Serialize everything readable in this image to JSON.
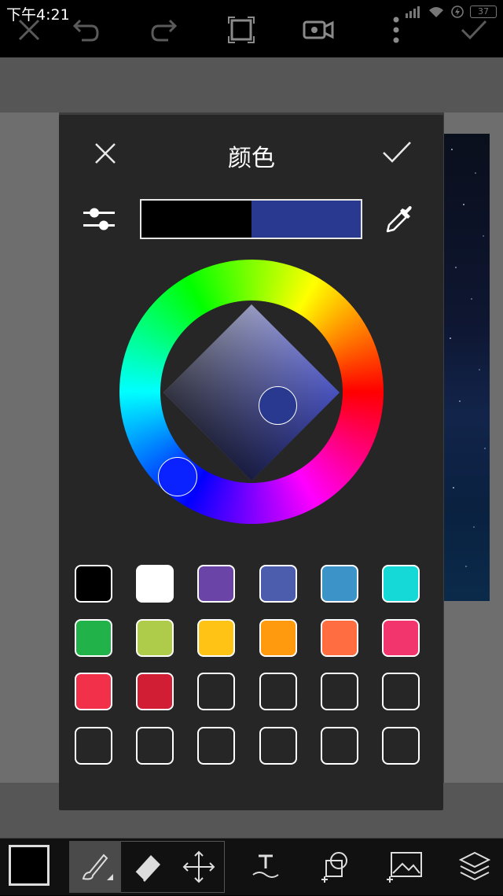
{
  "status_bar": {
    "time": "下午4:21",
    "battery": "37"
  },
  "toolbar_icons": [
    "close-icon",
    "undo-icon",
    "redo-icon",
    "crop-icon",
    "video-icon",
    "more-icon",
    "check-icon"
  ],
  "dialog": {
    "title": "颜色",
    "old_color": "#000000",
    "new_color": "#28398f",
    "selected_hue_color": "#0a22ff"
  },
  "swatches": [
    "#000000",
    "#ffffff",
    "#6a44a6",
    "#4d5dad",
    "#3c93c8",
    "#15d9d6",
    "#21b24a",
    "#afcb4a",
    "#ffc316",
    "#ff9a0f",
    "#ff6d40",
    "#f2366d",
    "#f2304a",
    "#d21e35",
    "empty",
    "empty",
    "empty",
    "empty",
    "empty",
    "empty",
    "empty",
    "empty",
    "empty",
    "empty"
  ],
  "bottom_tools": [
    "color-swatch",
    "brush-icon",
    "eraser-icon",
    "move-icon",
    "text-icon",
    "shapes-icon",
    "image-icon",
    "layers-icon"
  ]
}
